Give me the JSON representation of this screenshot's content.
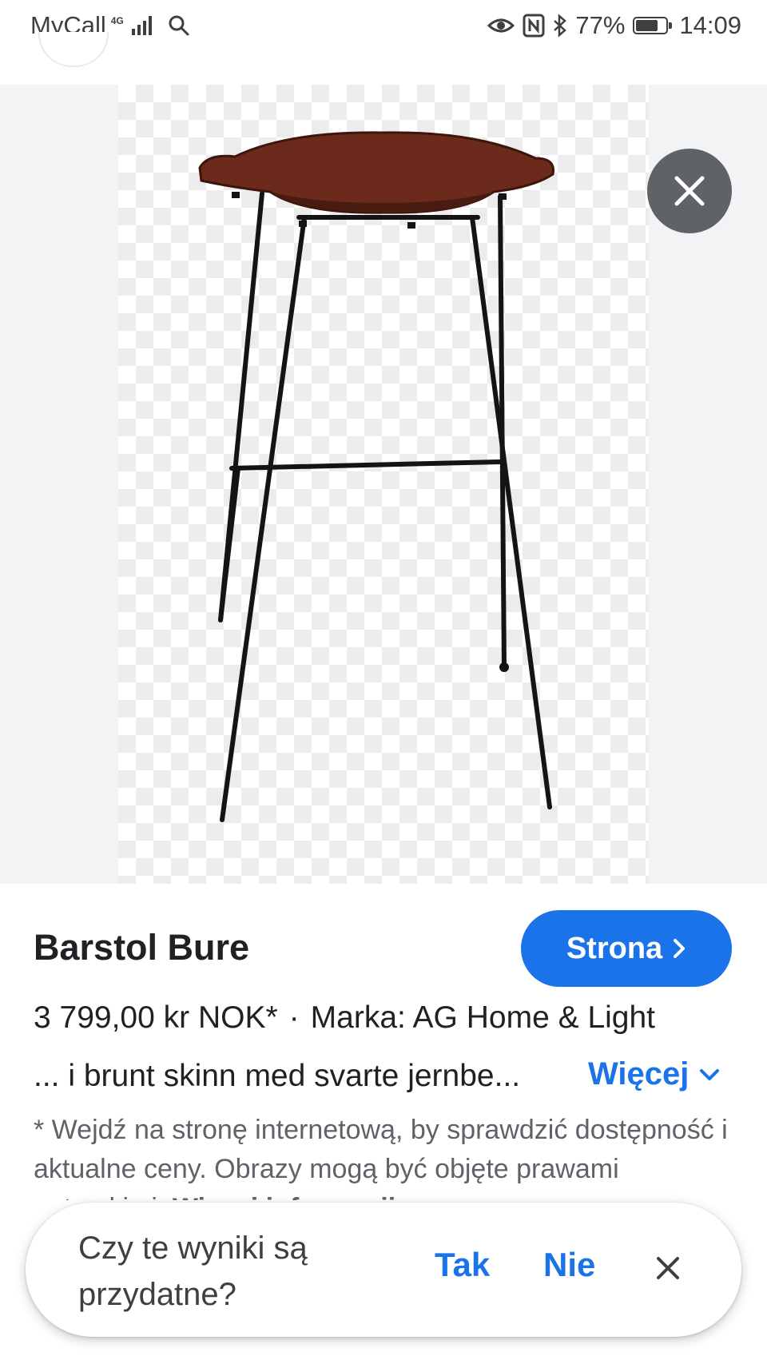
{
  "status_bar": {
    "carrier": "MyCall",
    "network": "4G",
    "battery": "77%",
    "battery_level": 0.77,
    "time": "14:09",
    "icons": [
      "search-icon",
      "eye-icon",
      "nfc-icon",
      "bluetooth-icon",
      "battery-icon",
      "signal-icon"
    ]
  },
  "viewer": {
    "close_icon": "close-icon",
    "image_subject": "bar stool with brown leather seat and black metal legs"
  },
  "product": {
    "title": "Barstol Bure",
    "visit_button": "Strona",
    "price": "3 799,00 kr NOK*",
    "separator": "·",
    "brand": "Marka: AG Home & Light",
    "description": "... i brunt skinn med svarte jernbe...",
    "more_label": "Więcej",
    "disclaimer_text": "* Wejdź na stronę internetową, by sprawdzić dostępność i aktualne ceny. Obrazy mogą być objęte prawami autorskimi.",
    "disclaimer_link": "Więcej informacji"
  },
  "feedback": {
    "question": "Czy te wyniki są przydatne?",
    "yes": "Tak",
    "no": "Nie"
  },
  "colors": {
    "accent": "#1a73e8",
    "close_button_bg": "#5f6368",
    "viewer_bg": "#f1f3f4",
    "seat_leather": "#6b2a1c"
  }
}
